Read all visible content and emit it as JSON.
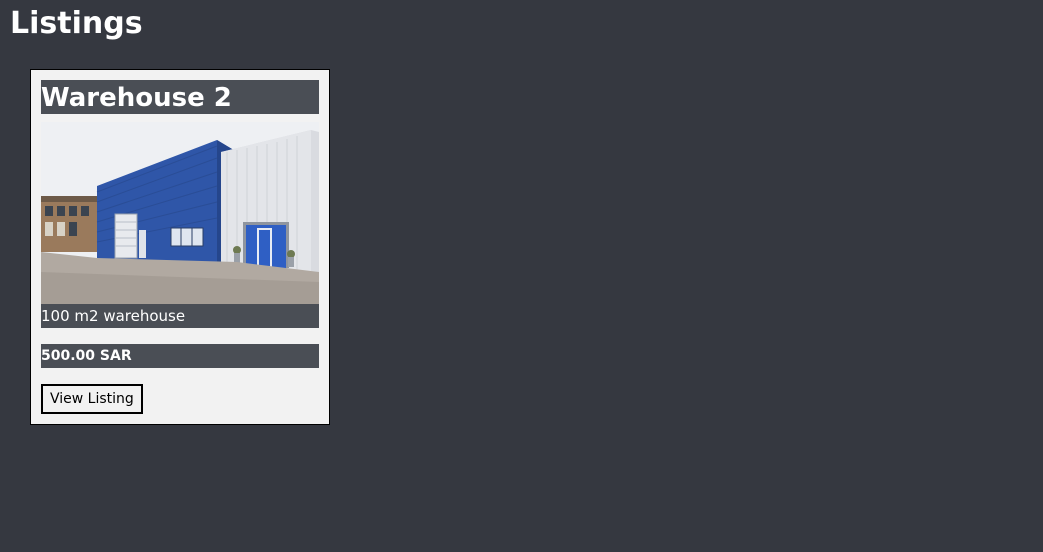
{
  "page": {
    "title": "Listings"
  },
  "listings": [
    {
      "title": "Warehouse 2",
      "image_alt": "warehouse photo",
      "description": "100 m2 warehouse",
      "price": "500.00 SAR",
      "button_label": "View Listing"
    }
  ],
  "colors": {
    "background": "#353840",
    "card_background": "#f2f2f2",
    "label_band": "#4a4e55",
    "text_light": "#ffffff"
  }
}
